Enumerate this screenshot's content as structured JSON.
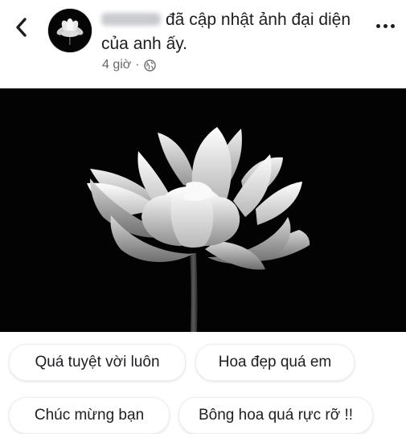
{
  "post": {
    "action_text": "đã cập nhật ảnh đại diện của anh ấy.",
    "time": "4 giờ",
    "separator": "·",
    "audience_icon": "globe-icon",
    "back_icon": "chevron-left-icon",
    "more_icon": "more-dots-icon"
  },
  "photo": {
    "subject": "white-lotus-flower",
    "background_color": "#030303"
  },
  "suggested_comments": [
    "Quá tuyệt vời luôn",
    "Hoa đẹp quá em",
    "Chúc mừng bạn",
    "Bông hoa quá rực rỡ !!"
  ],
  "colors": {
    "text_primary": "#1c1e21",
    "text_secondary": "#65676b",
    "chip_border": "#eceef0"
  }
}
